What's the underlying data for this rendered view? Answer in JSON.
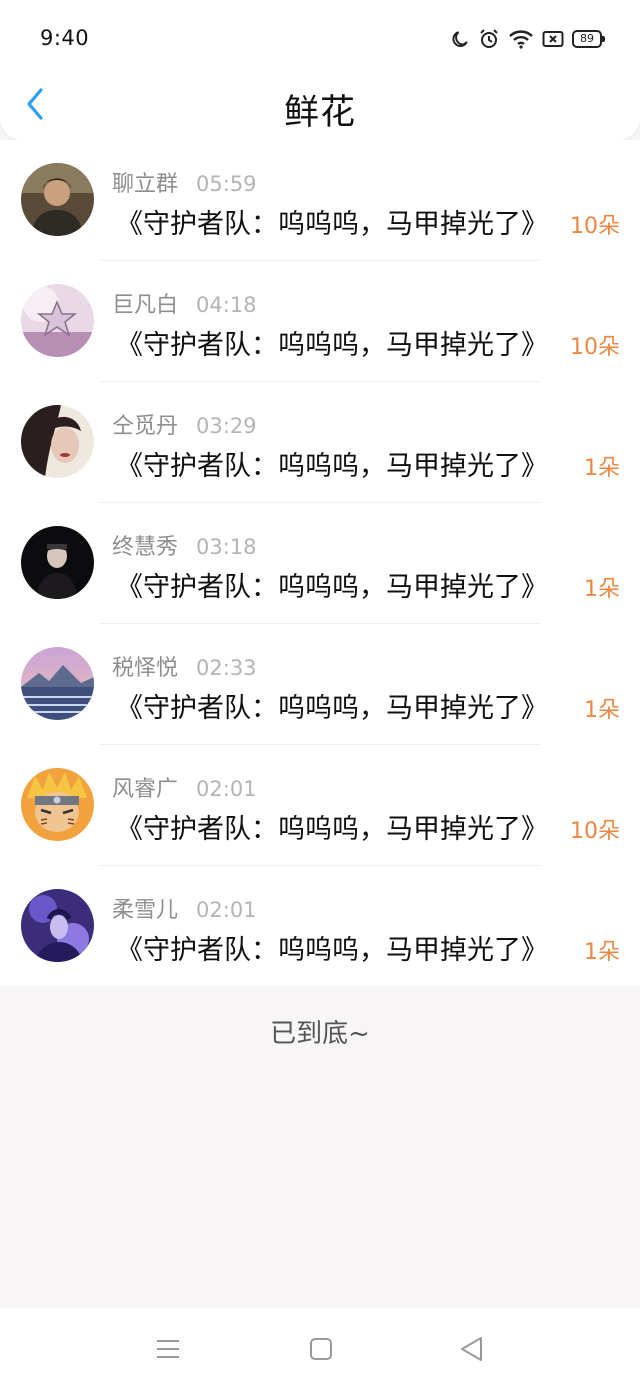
{
  "status_bar": {
    "time": "9:40",
    "battery": "89",
    "icons": [
      "moon-icon",
      "alarm-icon",
      "wifi-icon",
      "sim-card-icon",
      "battery-icon"
    ]
  },
  "header": {
    "title": "鲜花",
    "back_icon": "chevron-left-icon"
  },
  "colors": {
    "accent_blue": "#2a9df4",
    "flower_count": "#ee8641",
    "name": "#8e8e8e",
    "time": "#b4b4b4"
  },
  "rows": [
    {
      "name": "聊立群",
      "time": "05:59",
      "work": "《守护者队：呜呜呜，马甲掉光了》",
      "flowers": "10朵"
    },
    {
      "name": "巨凡白",
      "time": "04:18",
      "work": "《守护者队：呜呜呜，马甲掉光了》",
      "flowers": "10朵"
    },
    {
      "name": "仝觅丹",
      "time": "03:29",
      "work": "《守护者队：呜呜呜，马甲掉光了》",
      "flowers": "1朵"
    },
    {
      "name": "终慧秀",
      "time": "03:18",
      "work": "《守护者队：呜呜呜，马甲掉光了》",
      "flowers": "1朵"
    },
    {
      "name": "税怿悦",
      "time": "02:33",
      "work": "《守护者队：呜呜呜，马甲掉光了》",
      "flowers": "1朵"
    },
    {
      "name": "风睿广",
      "time": "02:01",
      "work": "《守护者队：呜呜呜，马甲掉光了》",
      "flowers": "10朵"
    },
    {
      "name": "柔雪儿",
      "time": "02:01",
      "work": "《守护者队：呜呜呜，马甲掉光了》",
      "flowers": "1朵"
    }
  ],
  "footer": {
    "end_text": "已到底~"
  },
  "nav_bar": {
    "buttons": [
      "menu-icon",
      "home-square-icon",
      "back-triangle-icon"
    ]
  }
}
